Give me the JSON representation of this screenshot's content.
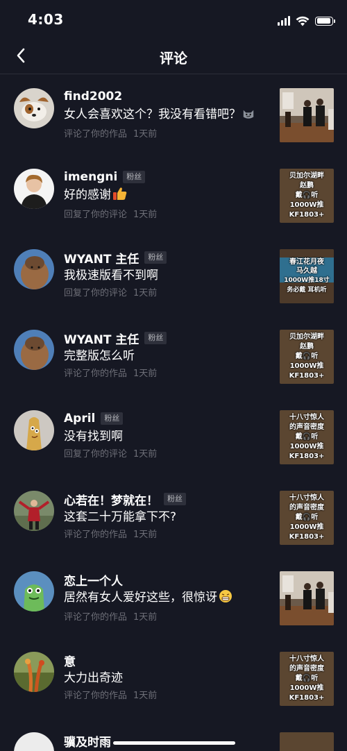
{
  "status_bar": {
    "time": "4:03"
  },
  "nav": {
    "title": "评论",
    "back_icon": "chevron-left-icon"
  },
  "colors": {
    "background": "#161823",
    "meta_text": "#6d6e77",
    "badge_bg": "#2e303b"
  },
  "comments": [
    {
      "username": "find2002",
      "badge": "",
      "text": "女人会喜欢这个？我没有看错吧？",
      "emoji": "smirk-cat-emoji",
      "action": "评论了你的作品",
      "time": "1天前",
      "thumbnail": {
        "kind": "room-photo",
        "lines": []
      }
    },
    {
      "username": "imengni",
      "badge": "粉丝",
      "text": "好的感谢",
      "emoji": "thumbs-up-emoji",
      "action": "回复了你的评论",
      "time": "1天前",
      "thumbnail": {
        "kind": "promo",
        "lines": [
          "贝加尔湖畔",
          "赵鹏",
          "戴🎧听",
          "1000W推",
          "KF1803+"
        ]
      }
    },
    {
      "username": "WYANT 主任",
      "badge": "粉丝",
      "text": "我极速版看不到啊",
      "emoji": "",
      "action": "回复了你的评论",
      "time": "1天前",
      "thumbnail": {
        "kind": "promo-blue",
        "lines": [
          "春江花月夜",
          "马久越",
          "1000W推18寸",
          "务必戴  耳机听"
        ]
      }
    },
    {
      "username": "WYANT 主任",
      "badge": "粉丝",
      "text": "完整版怎么听",
      "emoji": "",
      "action": "评论了你的作品",
      "time": "1天前",
      "thumbnail": {
        "kind": "promo",
        "lines": [
          "贝加尔湖畔",
          "赵鹏",
          "戴🎧听",
          "1000W推",
          "KF1803+"
        ]
      }
    },
    {
      "username": "April",
      "badge": "粉丝",
      "text": "没有找到啊",
      "emoji": "",
      "action": "回复了你的评论",
      "time": "1天前",
      "thumbnail": {
        "kind": "promo",
        "lines": [
          "十八寸惊人",
          "的声音密度",
          "戴🎧听",
          "1000W推",
          "KF1803+"
        ]
      }
    },
    {
      "username": "心若在！梦就在！",
      "badge": "粉丝",
      "text": "这套二十万能拿下不?",
      "emoji": "",
      "action": "评论了你的作品",
      "time": "1天前",
      "thumbnail": {
        "kind": "promo",
        "lines": [
          "十八寸惊人",
          "的声音密度",
          "戴🎧听",
          "1000W推",
          "KF1803+"
        ]
      }
    },
    {
      "username": "恋上一个人",
      "badge": "",
      "text": "居然有女人爱好这些，很惊讶",
      "emoji": "grin-emoji",
      "action": "评论了你的作品",
      "time": "1天前",
      "thumbnail": {
        "kind": "room-photo",
        "lines": []
      }
    },
    {
      "username": "意",
      "badge": "",
      "text": "大力出奇迹",
      "emoji": "",
      "action": "评论了你的作品",
      "time": "1天前",
      "thumbnail": {
        "kind": "promo",
        "lines": [
          "十八寸惊人",
          "的声音密度",
          "戴🎧听",
          "1000W推",
          "KF1803+"
        ]
      }
    },
    {
      "username": "骥及时雨",
      "badge": "",
      "text": "",
      "emoji": "",
      "action": "",
      "time": "",
      "thumbnail": {
        "kind": "promo",
        "lines": []
      }
    }
  ]
}
